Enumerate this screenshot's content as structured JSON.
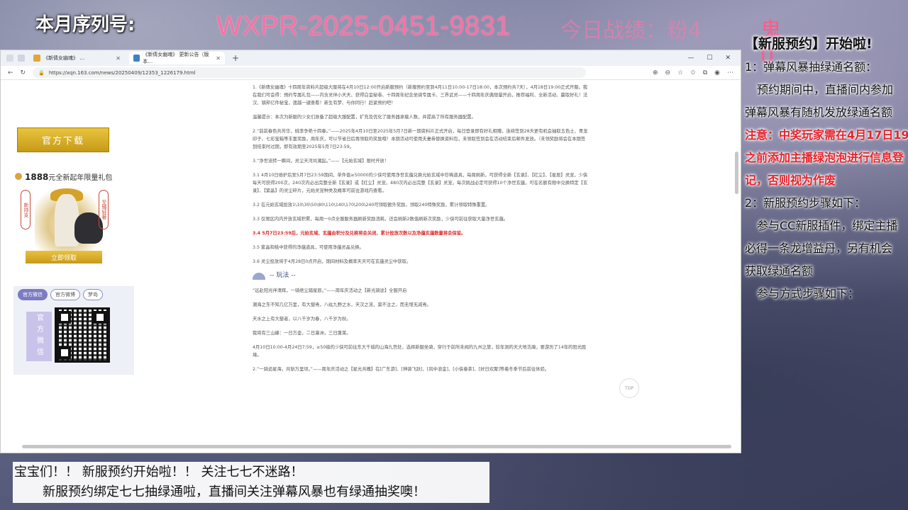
{
  "stream": {
    "serial_label": "本月序列号:",
    "serial_value": "WXPR-2025-0451-9831",
    "score_text": "今日战绩：粉4",
    "ghost_text": "鬼0"
  },
  "browser": {
    "tabs": [
      {
        "title": "《新倩女幽魂》 …",
        "active": false
      },
      {
        "title": "《新倩女幽魂》 更新公告（版本…",
        "active": true
      }
    ],
    "new_tab": "+",
    "window_controls": [
      "—",
      "☐",
      "✕"
    ],
    "url": "https://xqn.163.com/news/20250409/12353_1226179.html"
  },
  "sidebar": {
    "download_label": "官方下载",
    "giftpack_amount": "1888",
    "giftpack_text": "元全新起年限量礼包",
    "vertical_left": "新持支",
    "vertical_right": "至臻轻奢",
    "claim_label": "立即领取",
    "qr_tabs": [
      "官方微信",
      "官方微博",
      "梦岛"
    ],
    "qr_wechat": "官方微信"
  },
  "article": {
    "p1": "1.《新倩女幽魂》十四周年资料片超级大服将在4月10日12:00开启新服预约（新服预约至到4月11日10:00-17日18:00，本次预约共7天），4月18日19:00正式开服。我在我们可会得：预约专属礼包——内含灵伴小天天、获得白金秘卷、十四周年纪念坐骑专属卡、三界武灵——十四周年庆典限量开启，推荐福利、全新活动、赢取好礼！法汉、镇邦亿件秘宝，渡越一键查看！新生有梦、与你同行！赶紧预约吧！",
    "p2": "温馨提示：本次为新服的少女们准备了超级大服配置，扩充及优化了服务器承载人数，并提高了所有服务器配置。",
    "p3": "2.“前前春色共芳华，桃李争艳十四春。”——2025年4月10日至2025年5月7日新一期资料片正式开启，每日登录即有好礼相赠，连续签到28天更有机会抽取五色土、青龙印子、七彩宝箱等丰富奖励，周年庆，可以节省日后再领取的奖励哦！本期活动可使用夫妻券替换资料包，未领取签到会在活动结束后邮件发放。（未领奖励将会在本期签到结束时过期，即有效期至2025年5月7日23:59。",
    "p4": "3.“净世流转一瞬间，灵尘天河共潮起。”——【元始玄域】限时开放！",
    "p5": "3.1 4月10日维护后至5月7日23:59期间，单件值≥50000的少侠可使用净世玄蕴兑换元始玄域中珍稀道具，每周刷新，可获得全新【玄录】、【红尘】、【星辰】灵宠，少侠每天可获得200次，240次内必出完整全新【玄录】或【红尘】灵宠，480次内必出完整【玄录】灵宠，每次挑战必定可获得10个净世玄蕴，可在名额有限中兑换特定【玄录】、【紫晶】的灵尘碎片，元始灵宠种类及概率可前往游戏内查看。",
    "p6": "3.2 在元始玄域投放1\\10\\30\\50\\80\\110\\140\\170\\200\\240可领取额外奖励，领取240特殊奖励，累计领取特殊重置。",
    "p7": "3.3 仅限区内内开放玄域积累，每周一0点全服服务器刷新奖励消耗，还会刷新2数值刷新次奖励，少侠可前往获取大量净世玄蕴。",
    "p8": "3.4 5月7日23:59后，元始玄域、玄蕴由积分及兑换将会关闭，累计投放次数以及净蕴玄蕴数量将会保留。",
    "p9": "3.5 紫晶和桃中获得的净蕴道具，可使用净蕴灵晶兑换。",
    "p10": "3.6 灵尘投放将于4月28日0点开启，期间材料及概率天天可在玄蕴灵尘中获取。",
    "heading": "-- 玩法 --",
    "p11": "“远赴阳光伴清辉，一骑绝尘踏星辰。”——周年庆活动之【新光骑途】全服开启",
    "p12": "潮海之东不知几亿万里，有大壑焉，八纮九野之水，天汉之流，莫不注之，而无增无减焉。",
    "p13": "天水之上有大壑者，以八千岁为春，八千岁为秋。",
    "p14": "我将有三山峰：一日方壶，二日瀛洲，三日蓬莱。",
    "p15": "4月10日10:00-4月24日7:59，≥50级的少侠可前往东大千城的山海九宫处，选择新服坐骑，穿行于前所未闻的九州之旅，较年洞的天大地浩瀚，要游历了14年的阳光胜境。",
    "p16": "2.“一骑追星海，共斩万里坝。”——周年庆活动之【星光共魄】在[广东游]、[神骑飞跃]、[风中浪金]、[小侠春茶]、[好日欢聚]等着冬季节后前往体验。",
    "top_label": "TOP"
  },
  "announcement": {
    "heading": "【新服预约】开始啦!",
    "item1_title": "1：弹幕风暴抽绿通名额：",
    "item1_l1": "预约期间中，直播间内参加",
    "item1_l2": "弹幕风暴有随机发放绿通名额",
    "notice_l1": "注意：中奖玩家需在4月17日19点",
    "notice_l2": "之前添加主播绿泡泡进行信息登",
    "notice_l3": "记，否则视为作废",
    "item2_title": "2：新服预约步骤如下：",
    "item2_l1": "参与CC新服插件，绑定主播",
    "item2_l2": "必得一条龙增益丹，另有机会",
    "item2_l3": "获取绿通名额",
    "item2_l4": "参与方式步骤如下："
  },
  "banner": {
    "line1": "宝宝们！！ 新服预约开始啦！！ 关注七七不迷路！",
    "line2": "新服预约绑定七七抽绿通啦，直播间关注弹幕风暴也有绿通抽奖噢！"
  }
}
